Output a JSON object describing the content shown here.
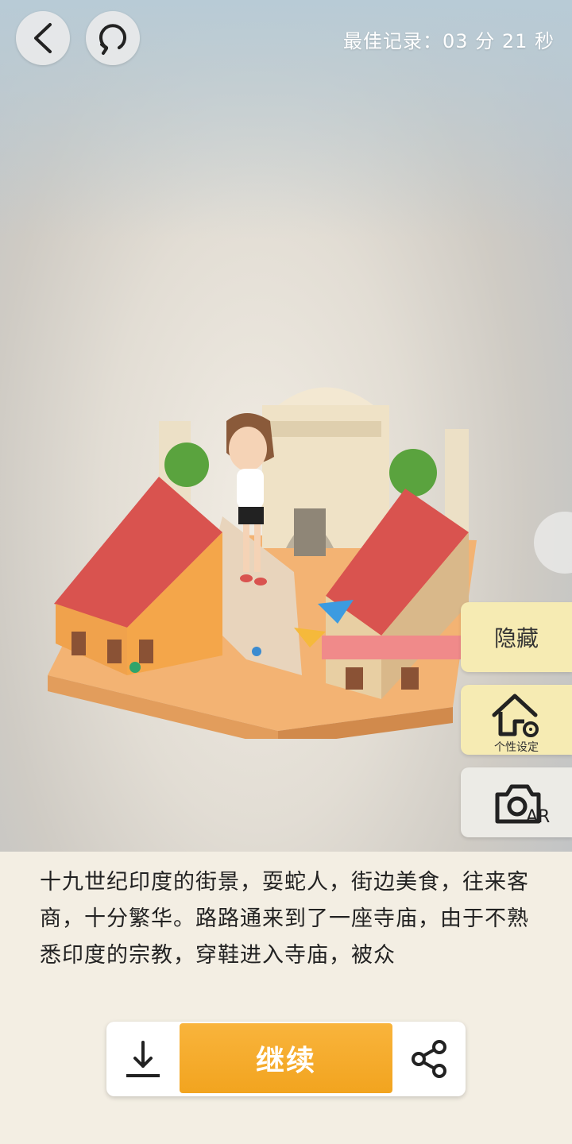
{
  "header": {
    "back_icon": "chevron-left-icon",
    "restart_icon": "refresh-icon",
    "best_record": "最佳记录：03 分 21 秒"
  },
  "scene": {
    "description_icon": "india-street-diorama"
  },
  "side_buttons": {
    "hide_label": "隐藏",
    "customize_label": "个性设定",
    "customize_icon": "house-gear-icon",
    "ar_label": "AR",
    "ar_icon": "camera-ar-icon"
  },
  "story": {
    "text": "十九世纪印度的街景，耍蛇人，街边美食，往来客商，十分繁华。路路通来到了一座寺庙，由于不熟悉印度的宗教，穿鞋进入寺庙，被众"
  },
  "actions": {
    "download_icon": "download-icon",
    "continue_label": "继续",
    "share_icon": "share-icon"
  },
  "colors": {
    "accent": "#f5a623",
    "side_button": "#f6ebb3",
    "panel": "#f3eee3"
  }
}
